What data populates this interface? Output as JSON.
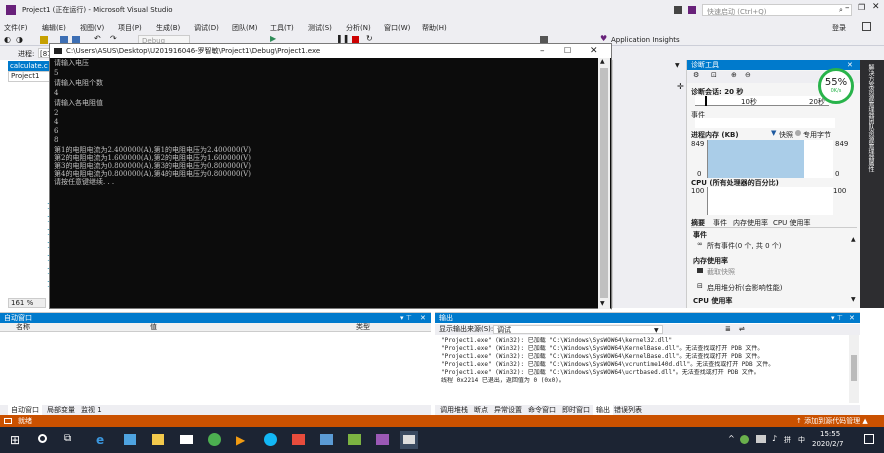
{
  "vs": {
    "title": "Project1 (正在运行) - Microsoft Visual Studio",
    "quick_launch": "快速启动 (Ctrl+Q)",
    "signin": "登录",
    "menu": [
      "文件(F)",
      "编辑(E)",
      "视图(V)",
      "项目(P)",
      "生成(B)",
      "调试(D)",
      "团队(M)",
      "工具(T)",
      "测试(S)",
      "分析(N)",
      "窗口(W)",
      "帮助(H)"
    ],
    "toolbar_debug": "Debug",
    "app_insights": "Application Insights",
    "process_label": "进程:",
    "process_value": "[870"
  },
  "editor": {
    "tab_label": "calculate.c",
    "scope_label": "Project1",
    "line_numbers": [
      "",
      "",
      "",
      "",
      "",
      "",
      "",
      "",
      "",
      "",
      "1",
      "1",
      "1",
      "1",
      "1",
      "1",
      "1"
    ],
    "zoom": "161 %"
  },
  "console": {
    "title": "C:\\Users\\ASUS\\Desktop\\U201916046-罗智敏\\Project1\\Debug\\Project1.exe",
    "lines": [
      "请输入电压",
      "5",
      "请输入电阻个数",
      "4",
      "请输入各电阻值",
      "2",
      "4",
      "6",
      "8",
      "第1的电阻电流为2.400000(A),第1的电阻电压为2.400000(V)",
      "第2的电阻电流为1.600000(A),第2的电阻电压为1.600000(V)",
      "第3的电阻电流为0.800000(A),第3的电阻电压为0.800000(V)",
      "第4的电阻电流为0.800000(A),第4的电阻电压为0.800000(V)",
      "请按任意键继续. . ."
    ]
  },
  "diagnostics": {
    "header": "诊断工具",
    "session_label": "诊断会话: 20 秒",
    "ruler_10": "10秒",
    "ruler_20": "20秒",
    "events_label": "事件",
    "memory_label": "进程内存 (KB)",
    "legend_snapshot": "快照",
    "legend_private": "专用字节",
    "mem_top": "849",
    "mem_top_r": "849",
    "mem_bot": "0",
    "mem_bot_r": "0",
    "cpu_label": "CPU (所有处理器的百分比)",
    "cpu_top": "100",
    "cpu_top_r": "100",
    "cpu_badge": "55%",
    "cpu_badge_sub": "0K/s",
    "tabs": [
      "摘要",
      "事件",
      "内存使用率",
      "CPU 使用率"
    ],
    "events_heading": "事件",
    "events_row": "所有事件(0 个, 共 0 个)",
    "memory_heading": "内存使用率",
    "snapshot_row": "截取快照",
    "heap_row": "启用堆分析(会影响性能)",
    "cpu_heading": "CPU 使用率"
  },
  "right_vtabs": [
    "解决方案资源管理器",
    "团队资源管理器",
    "属性"
  ],
  "autos": {
    "title": "自动窗口",
    "col_name": "名称",
    "col_value": "值",
    "col_type": "类型",
    "tabs": [
      "自动窗口",
      "局部变量",
      "监视 1"
    ]
  },
  "output": {
    "title": "输出",
    "source_label": "显示输出来源(S):",
    "source_value": "调试",
    "lines": [
      "\"Project1.exe\" (Win32): 已加载 \"C:\\Windows\\SysWOW64\\kernel32.dll\"",
      "\"Project1.exe\" (Win32): 已加载 \"C:\\Windows\\SysWOW64\\KernelBase.dll\"。无法查找或打开 PDB 文件。",
      "\"Project1.exe\" (Win32): 已加载 \"C:\\Windows\\SysWOW64\\KernelBase.dll\"。无法查找或打开 PDB 文件。",
      "\"Project1.exe\" (Win32): 已加载 \"C:\\Windows\\SysWOW64\\vcruntime140d.dll\"。无法查找或打开 PDB 文件。",
      "\"Project1.exe\" (Win32): 已加载 \"C:\\Windows\\SysWOW64\\ucrtbased.dll\"。无法查找或打开 PDB 文件。",
      "线程 0x2214 已退出，返回值为 0 (0x0)。"
    ],
    "tabs": [
      "调用堆栈",
      "断点",
      "异常设置",
      "命令窗口",
      "即时窗口",
      "输出",
      "错误列表"
    ]
  },
  "status": {
    "ready": "就绪",
    "add_source": "↑ 添加到源代码管理 ▲"
  },
  "taskbar": {
    "time": "15:55",
    "date": "2020/2/7",
    "lang": "中",
    "ime": "拼"
  },
  "colors": {
    "accent": "#007acc",
    "status": "#ca5100",
    "console_bg": "#0c0c0c",
    "taskbar": "#1c2433"
  }
}
